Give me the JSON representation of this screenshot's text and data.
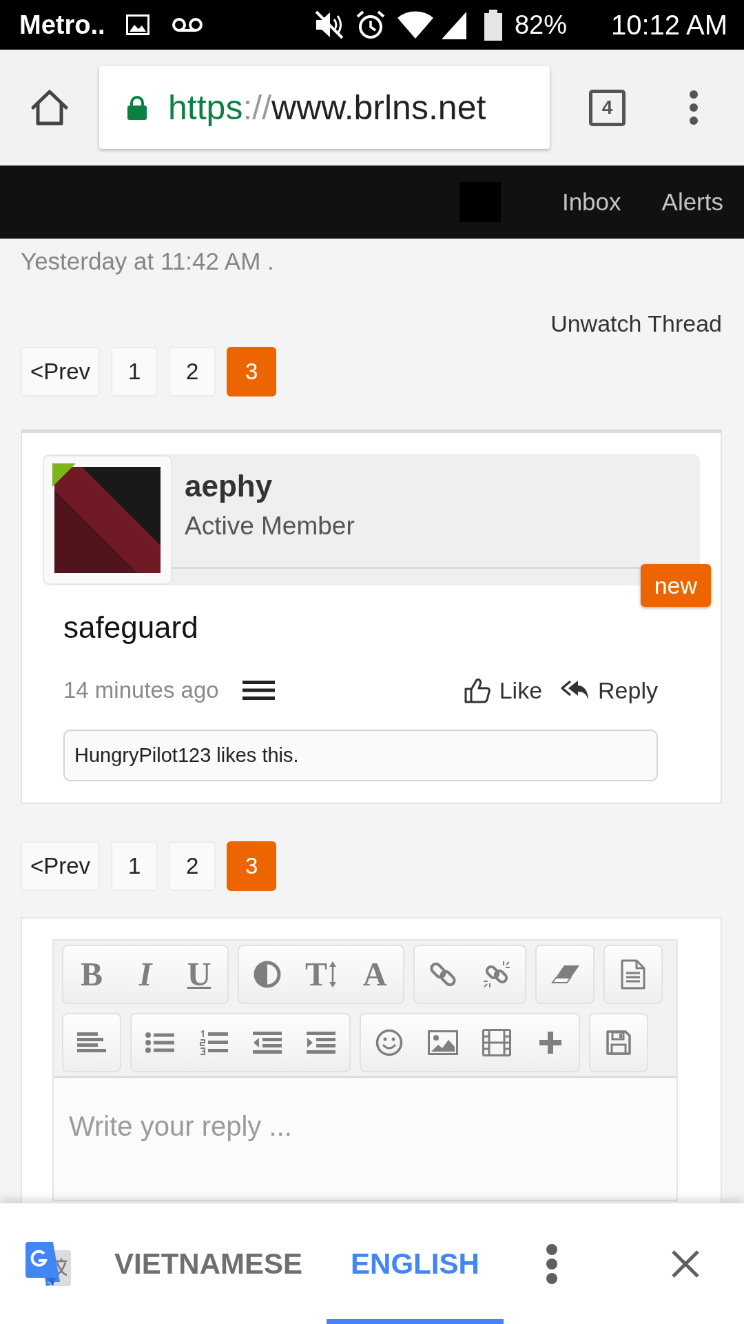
{
  "status_bar": {
    "carrier": "Metro..",
    "battery": "82%",
    "time": "10:12 AM"
  },
  "browser": {
    "url": {
      "scheme": "https",
      "separator": "://",
      "host": "www.brlns.net"
    },
    "tab_count": "4"
  },
  "site_nav": {
    "links": [
      "Inbox",
      "Alerts"
    ]
  },
  "thread": {
    "updated": "Yesterday at 11:42 AM .",
    "watch": "Unwatch Thread"
  },
  "pagination_top": [
    {
      "label": "<Prev",
      "selected": false
    },
    {
      "label": "1",
      "selected": false
    },
    {
      "label": "2",
      "selected": false
    },
    {
      "label": "3",
      "selected": true
    }
  ],
  "post": {
    "author": "aephy",
    "role": "Active Member",
    "badge": "new",
    "message": "safeguard",
    "time": "14 minutes ago",
    "actions": [
      {
        "kind": "like",
        "label": "Like"
      },
      {
        "kind": "reply",
        "label": "Reply"
      }
    ],
    "likes": "HungryPilot123 likes this."
  },
  "pagination_bottom": [
    {
      "label": "<Prev",
      "selected": false
    },
    {
      "label": "1",
      "selected": false
    },
    {
      "label": "2",
      "selected": false
    },
    {
      "label": "3",
      "selected": true
    }
  ],
  "editor": {
    "toolbar": [
      {
        "groups": [
          {
            "items": [
              {
                "kind": "bold",
                "label": "B"
              },
              {
                "kind": "italic",
                "label": "I"
              },
              {
                "kind": "underline",
                "label": "U"
              }
            ]
          },
          {
            "items": [
              {
                "kind": "color"
              },
              {
                "kind": "size",
                "label": "T"
              },
              {
                "kind": "font",
                "label": "A"
              }
            ]
          },
          {
            "items": [
              {
                "kind": "link"
              },
              {
                "kind": "unlink"
              }
            ]
          },
          {
            "items": [
              {
                "kind": "eraser"
              }
            ]
          },
          {
            "items": [
              {
                "kind": "template"
              }
            ]
          }
        ]
      },
      {
        "groups": [
          {
            "items": [
              {
                "kind": "align"
              }
            ]
          },
          {
            "items": [
              {
                "kind": "bullets"
              },
              {
                "kind": "numbers"
              },
              {
                "kind": "outdent"
              },
              {
                "kind": "indent"
              }
            ]
          },
          {
            "items": [
              {
                "kind": "smilie"
              },
              {
                "kind": "image"
              },
              {
                "kind": "media"
              },
              {
                "kind": "insert"
              }
            ]
          },
          {
            "items": [
              {
                "kind": "save"
              }
            ]
          }
        ]
      }
    ],
    "placeholder": "Write your reply ..."
  },
  "translate_bar": {
    "tabs": [
      {
        "label": "VIETNAMESE",
        "selected": false
      },
      {
        "label": "ENGLISH",
        "selected": true
      }
    ]
  }
}
